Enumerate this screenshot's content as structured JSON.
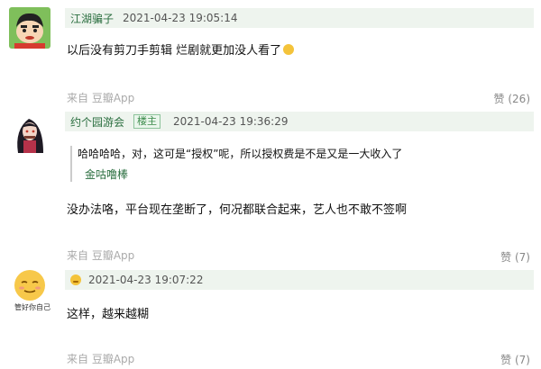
{
  "comments": [
    {
      "author": "江湖骗子",
      "time": "2021-04-23 19:05:14",
      "text": "以后没有剪刀手剪辑 烂剧就更加没人看了",
      "source": "来自 豆瓣App",
      "likes": "赞 (26)",
      "avatar_icon": "crayon-shinchan-avatar"
    },
    {
      "author": "约个园游会",
      "owner_badge": "楼主",
      "time": "2021-04-23 19:36:29",
      "quote_text": "哈哈哈哈，对，这可是“授权”呢，所以授权费是不是又是一大收入了",
      "quote_author": "金咕噜棒",
      "text": "没办法咯，平台现在垄断了，何况都联合起来，艺人也不敢不签啊",
      "source": "来自 豆瓣App",
      "likes": "赞 (7)",
      "avatar_icon": "anime-girl-avatar"
    },
    {
      "author_icon": "face-emoji",
      "time": "2021-04-23 19:07:22",
      "text": "这样，越来越糊",
      "source": "来自 豆瓣App",
      "likes": "赞 (7)",
      "avatar_icon": "smiley-avatar",
      "avatar_caption": "管好你自己"
    }
  ]
}
